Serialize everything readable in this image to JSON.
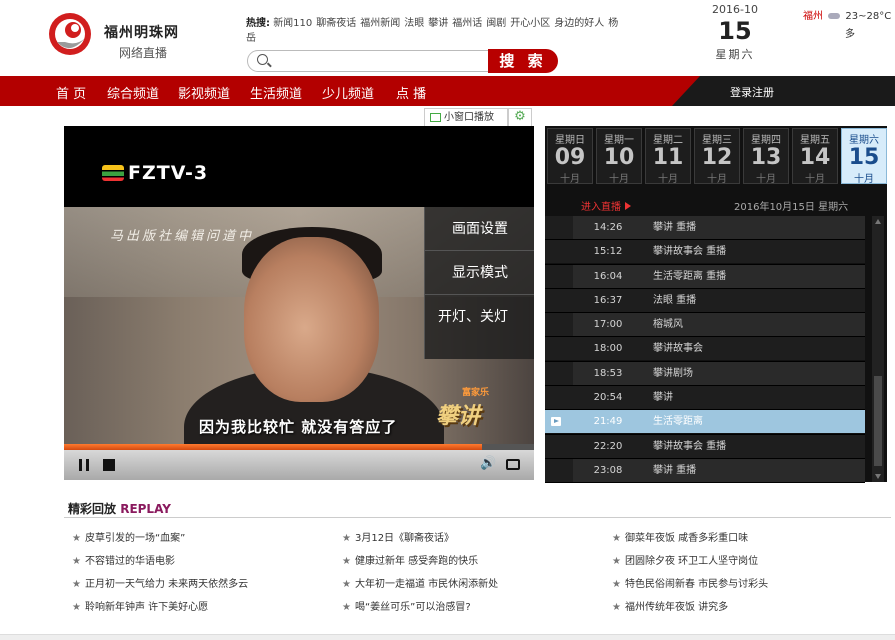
{
  "header": {
    "site_title": "福州明珠网",
    "site_subtitle": "网络直播",
    "hot_label": "热搜:",
    "hot_terms": [
      "新闻110",
      "聊斋夜话",
      "福州新闻",
      "法眼",
      "攀讲",
      "福州话",
      "闽剧",
      "开心小区",
      "身边的好人",
      "杨岳"
    ],
    "search_placeholder": "",
    "search_button": "搜 索",
    "date_ym": "2016-10",
    "date_day": "15",
    "date_weekday": "星期六",
    "weather_city": "福州",
    "weather_temp": "23~28°C",
    "weather_cond": "多"
  },
  "nav": {
    "items": [
      "首 页",
      "综合频道",
      "影视频道",
      "生活频道",
      "少儿频道",
      "点 播"
    ],
    "login": "登录注册"
  },
  "player": {
    "mini_window": "小窗口播放",
    "channel_logo": "FZTV-3",
    "calligraphy": "马出版社编辑问道中..",
    "subtitle": "因为我比较忙 就没有答应了",
    "watermark": "攀讲",
    "watermark_small": "富家乐",
    "menu": [
      "画面设置",
      "显示模式",
      "开灯、关灯"
    ],
    "progress": 0.89
  },
  "schedule": {
    "days": [
      {
        "weekday": "星期日",
        "day": "09",
        "month": "十月"
      },
      {
        "weekday": "星期一",
        "day": "10",
        "month": "十月"
      },
      {
        "weekday": "星期二",
        "day": "11",
        "month": "十月"
      },
      {
        "weekday": "星期三",
        "day": "12",
        "month": "十月"
      },
      {
        "weekday": "星期四",
        "day": "13",
        "month": "十月"
      },
      {
        "weekday": "星期五",
        "day": "14",
        "month": "十月"
      },
      {
        "weekday": "星期六",
        "day": "15",
        "month": "十月"
      }
    ],
    "active_day": 6,
    "live_label": "进入直播",
    "today_label": "2016年10月15日 星期六",
    "programs": [
      {
        "time": "14:26",
        "title": "攀讲 重播"
      },
      {
        "time": "15:12",
        "title": "攀讲故事会 重播"
      },
      {
        "time": "16:04",
        "title": "生活零距离 重播"
      },
      {
        "time": "16:37",
        "title": "法眼 重播"
      },
      {
        "time": "17:00",
        "title": "榕城风"
      },
      {
        "time": "18:00",
        "title": "攀讲故事会"
      },
      {
        "time": "18:53",
        "title": "攀讲剧场"
      },
      {
        "time": "20:54",
        "title": "攀讲"
      },
      {
        "time": "21:49",
        "title": "生活零距离"
      },
      {
        "time": "22:20",
        "title": "攀讲故事会 重播"
      },
      {
        "time": "23:08",
        "title": "攀讲 重播"
      }
    ],
    "current_index": 8
  },
  "replay": {
    "title": "精彩回放",
    "title_en": "REPLAY",
    "columns": [
      [
        "皮草引发的一场“血案”",
        "不容错过的华语电影",
        "正月初一天气给力 未来两天依然多云",
        "聆响新年钟声 许下美好心愿"
      ],
      [
        "3月12日《聊斋夜话》",
        "健康过新年 感受奔跑的快乐",
        "大年初一走福道 市民休闲添新处",
        "喝“姜丝可乐”可以治感冒?"
      ],
      [
        "御菜年夜饭 咸香多彩重口味",
        "团圆除夕夜 环卫工人坚守岗位",
        "特色民俗闹新春 市民参与讨彩头",
        "福州传统年夜饭 讲究多"
      ]
    ]
  },
  "colors": {
    "brand_red": "#b30000",
    "highlight_blue": "#9ec6df",
    "progress_orange": "#ff7a2f"
  }
}
